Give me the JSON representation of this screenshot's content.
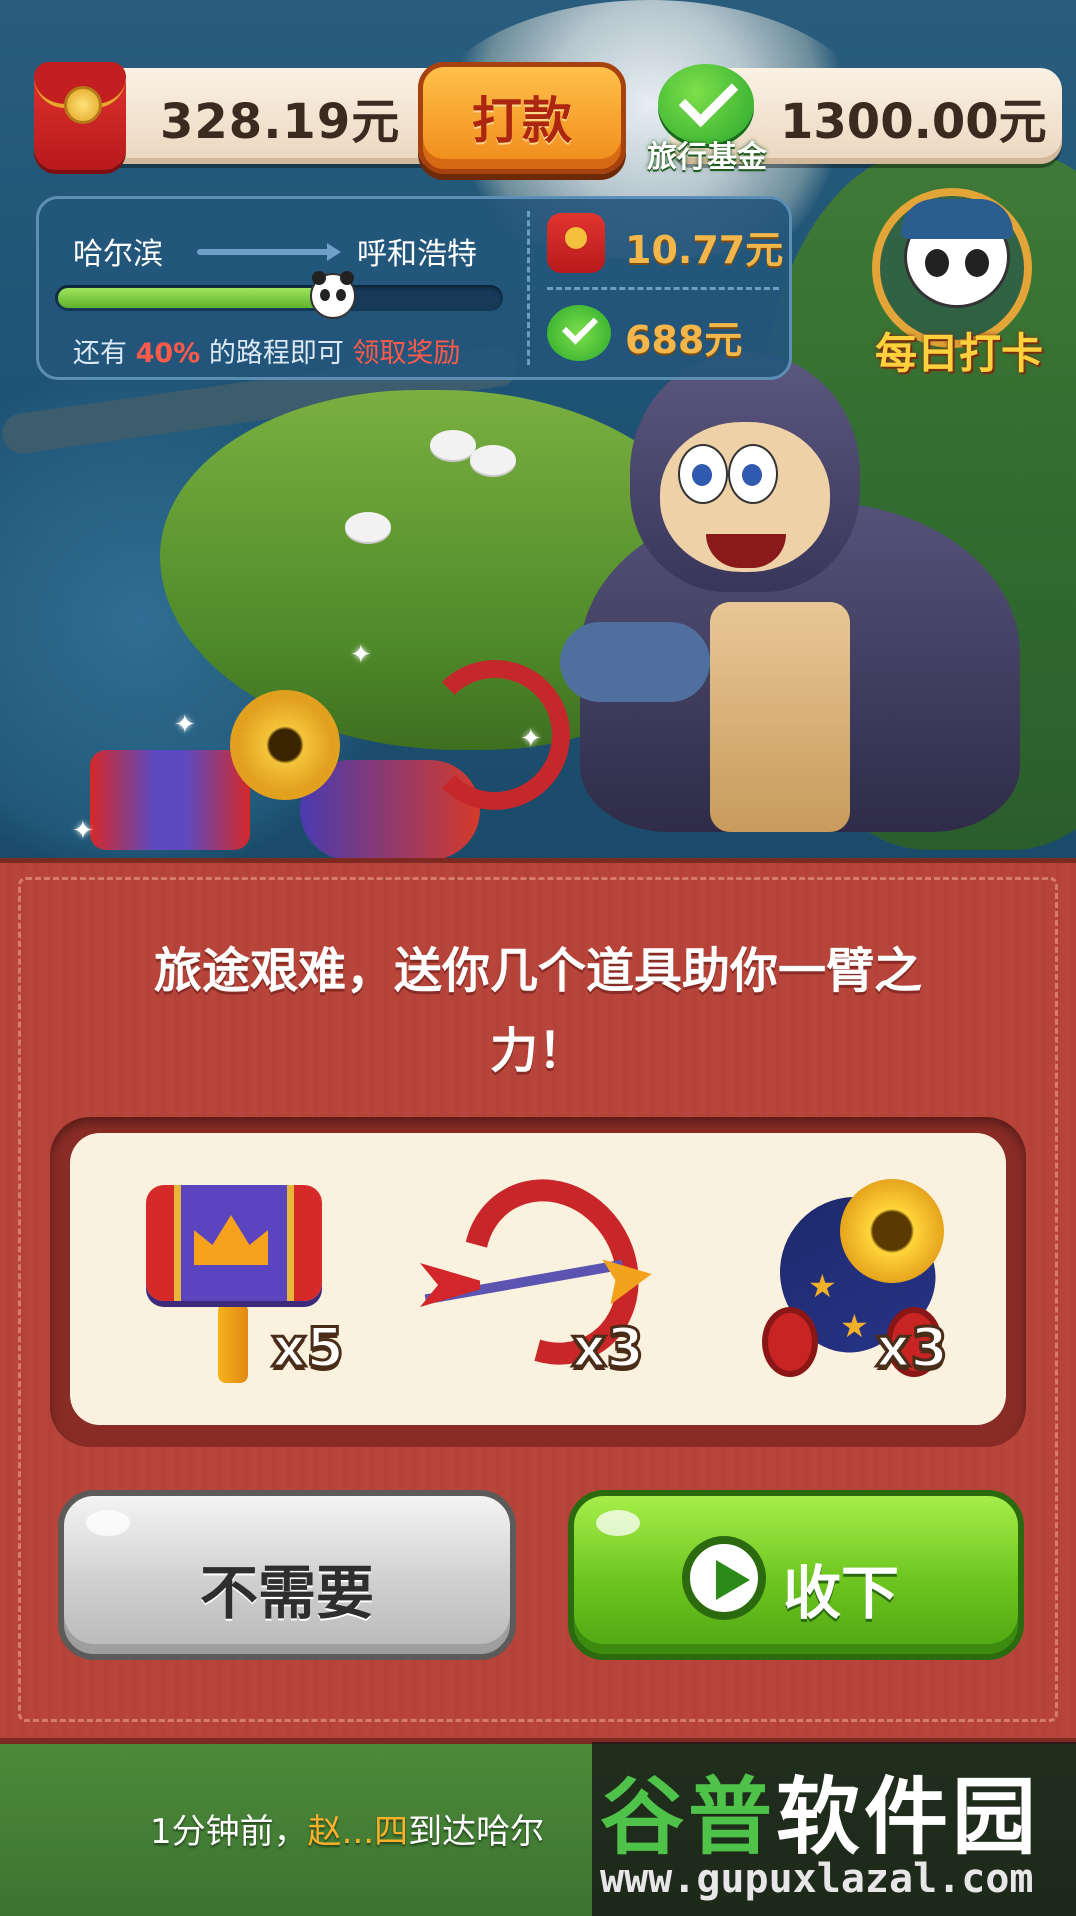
{
  "header": {
    "cash_amount": "328.19元",
    "payout_button": "打款",
    "fund_label": "旅行基金",
    "fund_amount": "1300.00元"
  },
  "route": {
    "from_city": "哈尔滨",
    "to_city": "呼和浩特",
    "progress_fraction": 0.6,
    "hint_prefix": "还有 ",
    "hint_percent": "40%",
    "hint_middle": " 的路程即可 ",
    "hint_claim": "领取奖励",
    "reward_cash": "10.77元",
    "reward_fund": "688元"
  },
  "checkin": {
    "label": "每日打卡"
  },
  "dialog": {
    "message": "旅途艰难，送你几个道具助你一臂之力！",
    "items": [
      {
        "icon": "hammer-icon",
        "count": "x5"
      },
      {
        "icon": "bow-arrow-icon",
        "count": "x3"
      },
      {
        "icon": "cannon-icon",
        "count": "x3"
      }
    ],
    "decline_button": "不需要",
    "accept_button": "收下"
  },
  "ticker": {
    "prefix": "1分钟前，",
    "name": "赵...四",
    "suffix": "到达哈尔"
  },
  "watermark": {
    "title_green": "谷普",
    "title_white": "软件园",
    "url": "www.gupuxlazal.com"
  },
  "colors": {
    "dialog_bg": "#b8453a",
    "accept_green": "#6cc41e",
    "payout_orange": "#f08a1a",
    "highlight_red": "#ff5a4a",
    "reward_gold": "#f2b64a"
  }
}
